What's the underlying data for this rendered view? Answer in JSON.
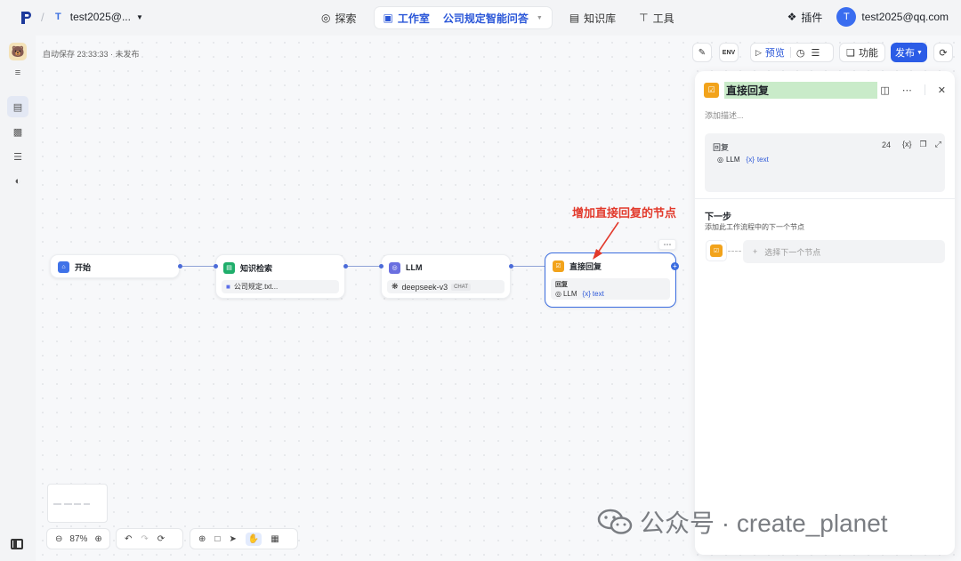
{
  "topbar": {
    "workspace_initial": "T",
    "workspace_name": "test2025@...",
    "nav": {
      "explore": "探索",
      "studio": "工作室",
      "app_name": "公司规定智能问答",
      "knowledge": "知识库",
      "tools": "工具"
    },
    "plugins": "插件",
    "user_initial": "T",
    "user_email": "test2025@qq.com"
  },
  "canvas": {
    "autosave": "自动保存 23:33:33 · 未发布"
  },
  "toolbar": {
    "preview": "预览",
    "features": "功能",
    "publish": "发布"
  },
  "nodes": {
    "start": {
      "title": "开始"
    },
    "knowledge": {
      "title": "知识检索",
      "file": "公司规定.txt..."
    },
    "llm": {
      "title": "LLM",
      "model": "deepseek-v3",
      "mode": "CHAT"
    },
    "answer": {
      "title": "直接回复",
      "field_label": "回复",
      "var_source": "LLM",
      "var_name": "text"
    }
  },
  "annotation": "增加直接回复的节点",
  "bottom_toolbar": {
    "zoom": "87%"
  },
  "panel": {
    "title": "直接回复",
    "description_placeholder": "添加描述...",
    "reply_label": "回复",
    "reply_count": "24",
    "reply_var_source": "LLM",
    "reply_var_name": "text",
    "next_step_title": "下一步",
    "next_step_desc": "添加此工作流程中的下一个节点",
    "next_step_select": "选择下一个节点"
  },
  "watermark": {
    "text": "公众号 · create_planet"
  },
  "colors": {
    "accent": "#2b5ce6",
    "annotation": "#e23a2c",
    "title_highlight": "#c9ebc9",
    "answer_icon": "#f2a31b",
    "knowledge_icon": "#1fae6b",
    "llm_icon": "#6a6fe0",
    "start_icon": "#3f72e8"
  }
}
